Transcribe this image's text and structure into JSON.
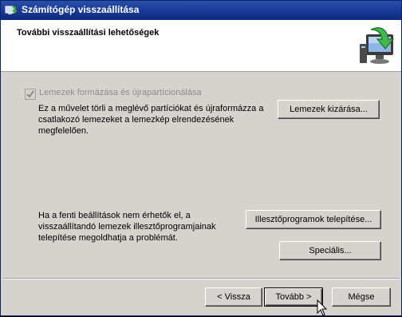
{
  "window": {
    "title": "Számítógép visszaállítása",
    "title_icon": "restore-app-icon"
  },
  "header": {
    "title": "További visszaállítási lehetőségek",
    "icon": "computer-restore-icon"
  },
  "format_option": {
    "checked": true,
    "enabled": false,
    "label": "Lemezek formázása és újrapartícionálása",
    "description": [
      "Ez a művelet törli a meglévő partíciókat és újraformázza a",
      "csatlakozó lemezeket a lemezkép elrendezésének",
      "megfelelően."
    ],
    "exclude_button": "Lemezek kizárása..."
  },
  "driver_section": {
    "description": [
      "Ha a fenti beállítások nem érhetők el, a",
      "visszaállítandó lemezek illesztőprogramjainak",
      "telepítése megoldhatja a problémát."
    ],
    "install_button": "Illesztőprogramok telepítése...",
    "advanced_button": "Speciális..."
  },
  "footer": {
    "back_button": "< Vissza",
    "next_button": "Tovább >",
    "cancel_button": "Mégse"
  }
}
